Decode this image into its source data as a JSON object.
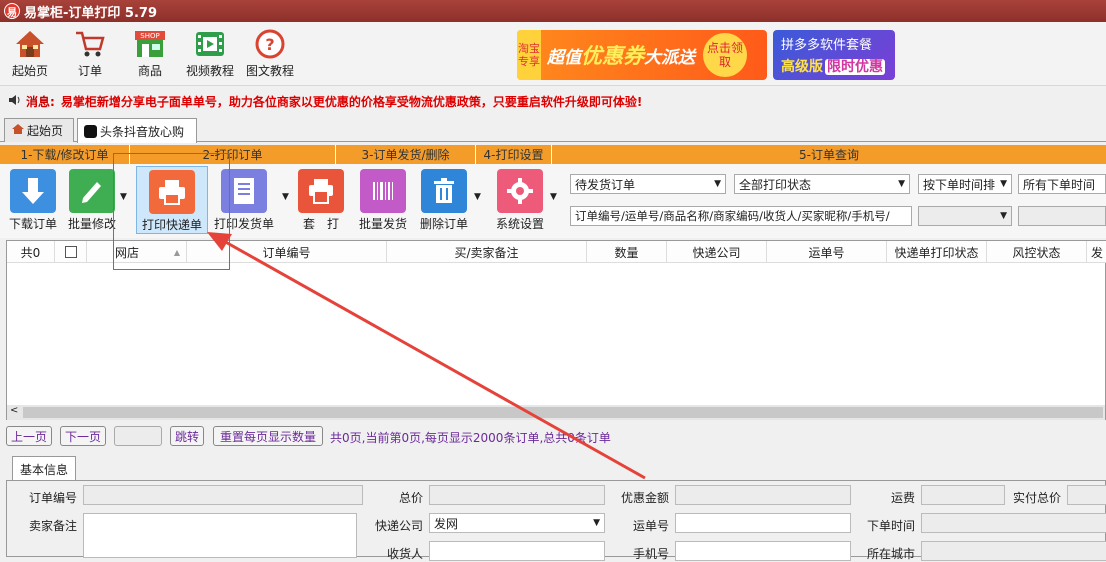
{
  "window": {
    "title": "易掌柜-订单打印 5.79",
    "app_icon_text": "易"
  },
  "topbar": {
    "items": [
      {
        "label": "起始页",
        "icon": "home-icon"
      },
      {
        "label": "订单",
        "icon": "cart-icon"
      },
      {
        "label": "商品",
        "icon": "shop-icon"
      },
      {
        "label": "视频教程",
        "icon": "video-icon"
      },
      {
        "label": "图文教程",
        "icon": "help-icon"
      }
    ],
    "shop_icon_text": "SHOP",
    "help_icon_text": "?",
    "banner1": {
      "tag": "淘宝专享",
      "text1": "超值",
      "text2": "优惠券",
      "text3": "大派送",
      "circle": "点击领取"
    },
    "banner2": {
      "line1": "拼多多软件套餐",
      "line2": "高级版",
      "badge": "限时优惠"
    }
  },
  "notice": {
    "label": "消息:",
    "text": "易掌柜新增分享电子面单单号，助力各位商家以更优惠的价格享受物流优惠政策，只要重启软件升级即可体验!"
  },
  "tabs": [
    {
      "label": "起始页"
    },
    {
      "label": "头条抖音放心购"
    }
  ],
  "steps": [
    "1-下载/修改订单",
    "2-打印订单",
    "3-订单发货/删除",
    "4-打印设置",
    "5-订单查询"
  ],
  "toolbar": {
    "buttons": [
      {
        "label": "下载订单",
        "icon": "download-icon"
      },
      {
        "label": "批量修改",
        "icon": "edit-icon"
      },
      {
        "label": "打印快递单",
        "icon": "printer-icon"
      },
      {
        "label": "打印发货单",
        "icon": "invoice-icon"
      },
      {
        "label": "套　打",
        "icon": "print-set-icon"
      },
      {
        "label": "批量发货",
        "icon": "barcode-icon"
      },
      {
        "label": "删除订单",
        "icon": "trash-icon"
      },
      {
        "label": "系统设置",
        "icon": "settings-icon"
      }
    ],
    "query": {
      "status": "待发货订单",
      "print_status": "全部打印状态",
      "sort": "按下单时间排",
      "time": "所有下单时间",
      "search_placeholder": "订单编号/运单号/商品名称/商家编码/收货人/买家昵称/手机号/"
    }
  },
  "grid": {
    "columns": [
      "共0",
      "",
      "网店",
      "订单编号",
      "买/卖家备注",
      "数量",
      "快递公司",
      "运单号",
      "快递单打印状态",
      "风控状态",
      "发"
    ]
  },
  "pager": {
    "prev": "上一页",
    "next": "下一页",
    "jump": "跳转",
    "reset": "重置每页显示数量",
    "status": "共0页,当前第0页,每页显示2000条订单,总共0条订单"
  },
  "info": {
    "tab": "基本信息",
    "labels": {
      "order_no": "订单编号",
      "total": "总价",
      "discount": "优惠金额",
      "freight": "运费",
      "paid": "实付总价",
      "seller_note": "卖家备注",
      "courier": "快递公司",
      "waybill": "运单号",
      "order_time": "下单时间",
      "shipper": "收货人",
      "phone": "手机号",
      "city": "所在城市"
    },
    "courier_value": "发网"
  },
  "colors": {
    "accent": "#f39c2a",
    "titlebar": "#8e2f2a",
    "annotation": "#e5433a"
  }
}
